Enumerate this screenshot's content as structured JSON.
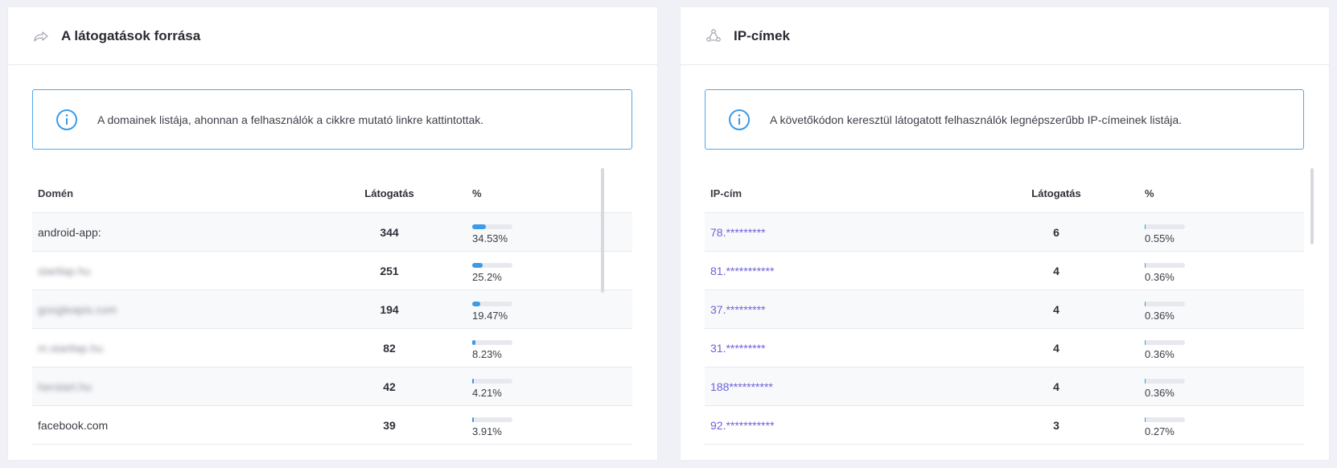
{
  "left": {
    "title": "A látogatások forrása",
    "info": "A domainek listája, ahonnan a felhasználók a cikkre mutató linkre kattintottak.",
    "headers": {
      "c1": "Domén",
      "c2": "Látogatás",
      "c3": "%"
    },
    "rows": [
      {
        "name": "android-app:",
        "visits": "344",
        "pct": "34.53%",
        "frac": 0.3453,
        "blurred": false
      },
      {
        "name": "startlap.hu",
        "visits": "251",
        "pct": "25.2%",
        "frac": 0.252,
        "blurred": true
      },
      {
        "name": "googleapis.com",
        "visits": "194",
        "pct": "19.47%",
        "frac": 0.1947,
        "blurred": true
      },
      {
        "name": "m.startlap.hu",
        "visits": "82",
        "pct": "8.23%",
        "frac": 0.0823,
        "blurred": true
      },
      {
        "name": "herstart.hu",
        "visits": "42",
        "pct": "4.21%",
        "frac": 0.0421,
        "blurred": true
      },
      {
        "name": "facebook.com",
        "visits": "39",
        "pct": "3.91%",
        "frac": 0.0391,
        "blurred": false
      }
    ]
  },
  "right": {
    "title": "IP-címek",
    "info": "A követőkódon keresztül látogatott felhasználók legnépszerűbb IP-címeinek listája.",
    "headers": {
      "c1": "IP-cím",
      "c2": "Látogatás",
      "c3": "%"
    },
    "rows": [
      {
        "name": "78.*********",
        "visits": "6",
        "pct": "0.55%",
        "frac": 0.0055
      },
      {
        "name": "81.***********",
        "visits": "4",
        "pct": "0.36%",
        "frac": 0.0036
      },
      {
        "name": "37.*********",
        "visits": "4",
        "pct": "0.36%",
        "frac": 0.0036
      },
      {
        "name": "31.*********",
        "visits": "4",
        "pct": "0.36%",
        "frac": 0.0036
      },
      {
        "name": "188**********",
        "visits": "4",
        "pct": "0.36%",
        "frac": 0.0036
      },
      {
        "name": "92.***********",
        "visits": "3",
        "pct": "0.27%",
        "frac": 0.0027
      }
    ]
  },
  "icons": {
    "left_header": "share-arrow-icon",
    "right_header": "network-nodes-icon",
    "info": "info-circle-icon"
  },
  "colors": {
    "accent": "#3b9be6",
    "ip_link": "#6c63d9",
    "info_border": "#56a6e8"
  }
}
